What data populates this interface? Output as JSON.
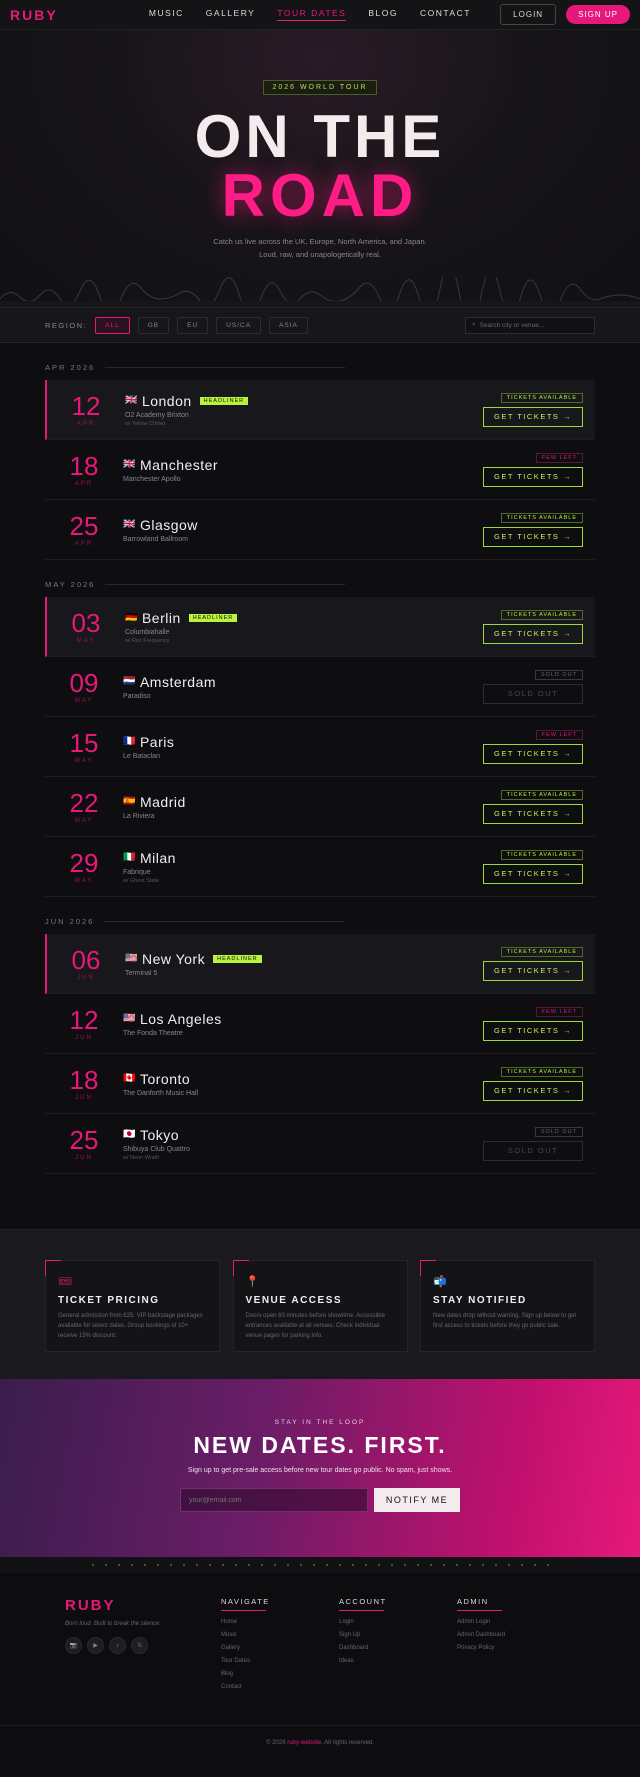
{
  "nav": {
    "logo": "RUBY",
    "links": [
      "MUSIC",
      "GALLERY",
      "TOUR DATES",
      "BLOG",
      "CONTACT"
    ],
    "active": "TOUR DATES",
    "login": "LOGIN",
    "signup": "SIGN UP"
  },
  "hero": {
    "tag": "2026 WORLD TOUR",
    "title1": "ON THE",
    "title2": "ROAD",
    "subtitle1": "Catch us live across the UK, Europe, North America, and Japan.",
    "subtitle2": "Loud, raw, and unapologetically real."
  },
  "filter": {
    "label": "REGION:",
    "chips": [
      "ALL",
      "GB",
      "EU",
      "US/CA",
      "ASIA"
    ],
    "active": "ALL",
    "search_placeholder": "Search city or venue..."
  },
  "months": [
    {
      "label": "APR 2026",
      "shows": [
        {
          "day": "12",
          "mon": "APR",
          "flag": "🇬🇧",
          "city": "London",
          "headliner": "HEADLINER",
          "venue": "O2 Academy Brixton",
          "sub": "w/ Yellow Chilies",
          "status": "TICKETS AVAILABLE",
          "stype": "av",
          "btn": "GET TICKETS →",
          "hl": true
        },
        {
          "day": "18",
          "mon": "APR",
          "flag": "🇬🇧",
          "city": "Manchester",
          "headliner": "",
          "venue": "Manchester Apollo",
          "sub": "",
          "status": "FEW LEFT",
          "stype": "few",
          "btn": "GET TICKETS →",
          "hl": false
        },
        {
          "day": "25",
          "mon": "APR",
          "flag": "🇬🇧",
          "city": "Glasgow",
          "headliner": "",
          "venue": "Barrowland Ballroom",
          "sub": "",
          "status": "TICKETS AVAILABLE",
          "stype": "av",
          "btn": "GET TICKETS →",
          "hl": false
        }
      ]
    },
    {
      "label": "MAY 2026",
      "shows": [
        {
          "day": "03",
          "mon": "MAY",
          "flag": "🇩🇪",
          "city": "Berlin",
          "headliner": "HEADLINER",
          "venue": "Columbiahalle",
          "sub": "w/ Riot Frequency",
          "status": "TICKETS AVAILABLE",
          "stype": "av",
          "btn": "GET TICKETS →",
          "hl": true
        },
        {
          "day": "09",
          "mon": "MAY",
          "flag": "🇳🇱",
          "city": "Amsterdam",
          "headliner": "",
          "venue": "Paradiso",
          "sub": "",
          "status": "SOLD OUT",
          "stype": "sold",
          "btn": "SOLD OUT",
          "hl": false
        },
        {
          "day": "15",
          "mon": "MAY",
          "flag": "🇫🇷",
          "city": "Paris",
          "headliner": "",
          "venue": "Le Bataclan",
          "sub": "",
          "status": "FEW LEFT",
          "stype": "few",
          "btn": "GET TICKETS →",
          "hl": false
        },
        {
          "day": "22",
          "mon": "MAY",
          "flag": "🇪🇸",
          "city": "Madrid",
          "headliner": "",
          "venue": "La Riviera",
          "sub": "",
          "status": "TICKETS AVAILABLE",
          "stype": "av",
          "btn": "GET TICKETS →",
          "hl": false
        },
        {
          "day": "29",
          "mon": "MAY",
          "flag": "🇮🇹",
          "city": "Milan",
          "headliner": "",
          "venue": "Fabrique",
          "sub": "w/ Ghost State",
          "status": "TICKETS AVAILABLE",
          "stype": "av",
          "btn": "GET TICKETS →",
          "hl": false
        }
      ]
    },
    {
      "label": "JUN 2026",
      "shows": [
        {
          "day": "06",
          "mon": "JUN",
          "flag": "🇺🇸",
          "city": "New York",
          "headliner": "HEADLINER",
          "venue": "Terminal 5",
          "sub": "",
          "status": "TICKETS AVAILABLE",
          "stype": "av",
          "btn": "GET TICKETS →",
          "hl": true
        },
        {
          "day": "12",
          "mon": "JUN",
          "flag": "🇺🇸",
          "city": "Los Angeles",
          "headliner": "",
          "venue": "The Fonda Theatre",
          "sub": "",
          "status": "FEW LEFT",
          "stype": "few",
          "btn": "GET TICKETS →",
          "hl": false
        },
        {
          "day": "18",
          "mon": "JUN",
          "flag": "🇨🇦",
          "city": "Toronto",
          "headliner": "",
          "venue": "The Danforth Music Hall",
          "sub": "",
          "status": "TICKETS AVAILABLE",
          "stype": "av",
          "btn": "GET TICKETS →",
          "hl": false
        },
        {
          "day": "25",
          "mon": "JUN",
          "flag": "🇯🇵",
          "city": "Tokyo",
          "headliner": "",
          "venue": "Shibuya Club Quattro",
          "sub": "w/ Neon Wrath",
          "status": "SOLD OUT",
          "stype": "sold",
          "btn": "SOLD OUT",
          "hl": false
        }
      ]
    }
  ],
  "info": [
    {
      "icon": "ticket-icon",
      "glyph": "🎟",
      "title": "TICKET PRICING",
      "text": "General admission from £25. VIP backstage packages available for select dates. Group bookings of 10+ receive 15% discount."
    },
    {
      "icon": "pin-icon",
      "glyph": "📍",
      "title": "VENUE ACCESS",
      "text": "Doors open 60 minutes before showtime. Accessible entrances available at all venues. Check individual venue pages for parking info."
    },
    {
      "icon": "mailbox-icon",
      "glyph": "📬",
      "title": "STAY NOTIFIED",
      "text": "New dates drop without warning. Sign up below to get first access to tickets before they go public sale."
    }
  ],
  "cta": {
    "kicker": "STAY IN THE LOOP",
    "title": "NEW DATES. FIRST.",
    "text": "Sign up to get pre-sale access before new tour dates go public. No spam, just shows.",
    "placeholder": "your@email.com",
    "button": "NOTIFY ME"
  },
  "footer": {
    "logo": "RUBY",
    "tagline": "Born loud. Built to break the silence.",
    "social": [
      "📷",
      "▶",
      "♪",
      "𝕏"
    ],
    "columns": [
      {
        "title": "NAVIGATE",
        "links": [
          "Home",
          "Music",
          "Gallery",
          "Tour Dates",
          "Blog",
          "Contact"
        ]
      },
      {
        "title": "ACCOUNT",
        "links": [
          "Login",
          "Sign Up",
          "Dashboard",
          "Ideas"
        ]
      },
      {
        "title": "ADMIN",
        "links": [
          "Admin Login",
          "Admin Dashboard",
          "Privacy Policy"
        ]
      }
    ],
    "copy_pre": "© 2026 ",
    "copy_link": "ruby-website",
    "copy_post": ". All rights reserved."
  },
  "colors": {
    "accent": "#e6197a",
    "lime": "#b8f23a",
    "bg": "#0e0d10"
  }
}
